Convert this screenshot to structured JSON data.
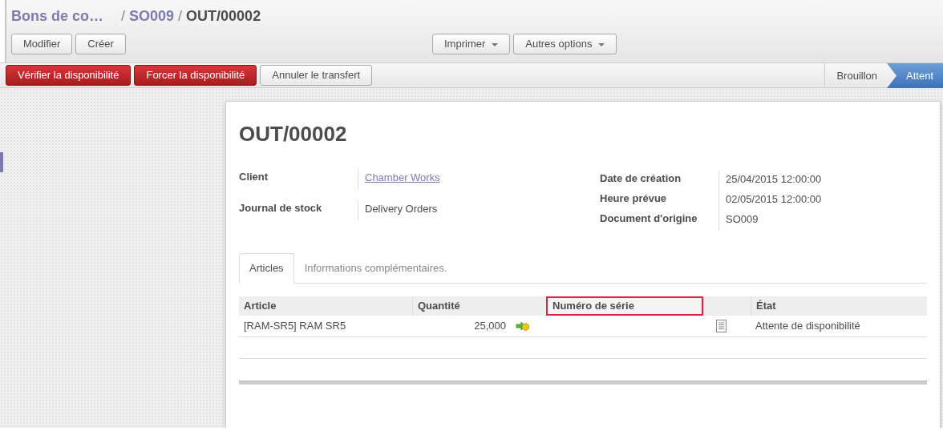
{
  "breadcrumb": {
    "separator": "/",
    "items": [
      {
        "label": "Bons de co…",
        "link": true
      },
      {
        "label": "SO009",
        "link": true
      },
      {
        "label": "OUT/00002",
        "link": false
      }
    ]
  },
  "toolbar": {
    "buttons": [
      "Modifier",
      "Créer"
    ],
    "dropdowns": [
      "Imprimer",
      "Autres options"
    ]
  },
  "actions": [
    {
      "label": "Vérifier la disponibilité",
      "kind": "primary"
    },
    {
      "label": "Forcer la disponibilité",
      "kind": "primary"
    },
    {
      "label": "Annuler le transfert",
      "kind": "default"
    }
  ],
  "stages": [
    {
      "label": "Brouillon",
      "selected": false
    },
    {
      "label": "Attent",
      "selected": true
    }
  ],
  "sheet": {
    "title": "OUT/00002",
    "fields_left": [
      {
        "label": "Client",
        "value": "Chamber Works",
        "kind": "link"
      },
      {
        "label": "Journal de stock",
        "value": "Delivery Orders",
        "kind": "text"
      }
    ],
    "fields_right": [
      {
        "label": "Date de création",
        "value": "25/04/2015 12:00:00",
        "kind": "text"
      },
      {
        "label": "Heure prévue",
        "value": "02/05/2015 12:00:00",
        "kind": "text"
      },
      {
        "label": "Document d'origine",
        "value": "SO009",
        "kind": "text"
      }
    ],
    "tabs": [
      {
        "label": "Articles",
        "selected": true
      },
      {
        "label": "Informations complémentaires.",
        "selected": false
      }
    ],
    "table": {
      "columns": [
        {
          "label": "Article",
          "highlighted": false
        },
        {
          "label": "Quantité",
          "highlighted": false
        },
        {
          "label": "Numéro de série",
          "highlighted": true
        },
        {
          "highlighted": false
        },
        {
          "label": "État",
          "highlighted": false
        }
      ],
      "rows": [
        {
          "article": "[RAM-SR5] RAM SR5",
          "quantity": "25,000",
          "state": "Attente de disponibilité"
        }
      ]
    }
  }
}
